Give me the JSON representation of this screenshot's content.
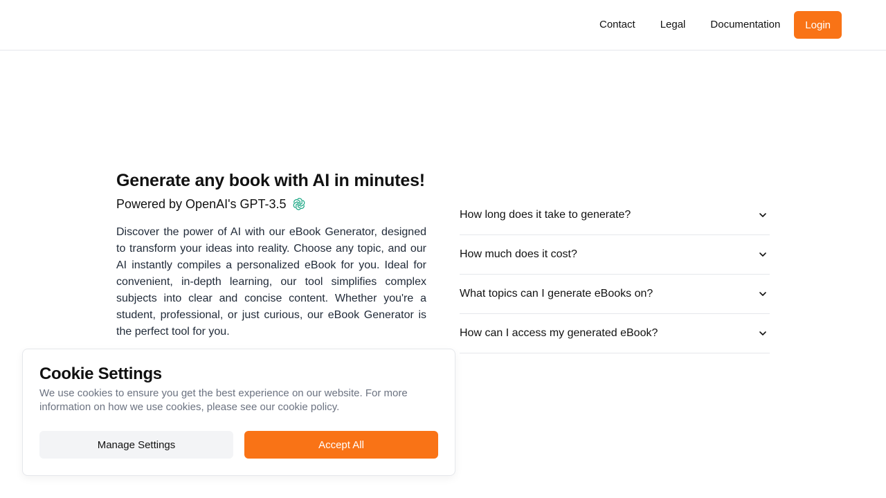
{
  "nav": {
    "links": [
      "Contact",
      "Legal",
      "Documentation"
    ],
    "login_label": "Login"
  },
  "hero": {
    "title": "Generate any book with AI in minutes!",
    "subtitle": "Powered by OpenAI's GPT-3.5",
    "description": "Discover the power of AI with our eBook Generator, designed to transform your ideas into reality. Choose any topic, and our AI instantly compiles a personalized eBook for you. Ideal for convenient, in-depth learning, our tool simplifies complex subjects into clear and concise content. Whether you're a student, professional, or just curious, our eBook Generator is the perfect tool for you."
  },
  "faq": {
    "items": [
      "How long does it take to generate?",
      "How much does it cost?",
      "What topics can I generate eBooks on?",
      "How can I access my generated eBook?"
    ]
  },
  "cookie": {
    "title": "Cookie Settings",
    "text": "We use cookies to ensure you get the best experience on our website. For more information on how we use cookies, please see our cookie policy.",
    "manage_label": "Manage Settings",
    "accept_label": "Accept All"
  },
  "colors": {
    "accent": "#f97316",
    "openai_icon": "#10a37f"
  },
  "icons": {
    "openai": "openai-logo-icon",
    "chevron": "chevron-down-icon"
  }
}
